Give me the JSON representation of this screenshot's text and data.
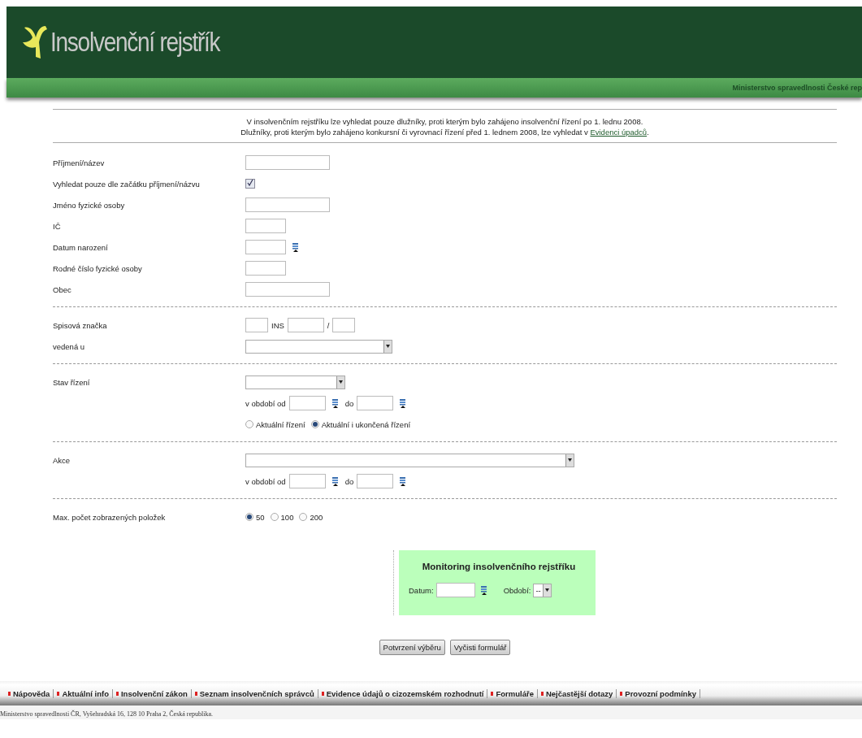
{
  "header": {
    "title": "Insolvenční rejstřík",
    "ministry": "Ministerstvo spravedlnosti České rep"
  },
  "notice": {
    "line_1": "V insolvenčním rejstříku lze vyhledat pouze dlužníky, proti kterým bylo zahájeno insolvenční řízení po 1. lednu 2008.",
    "line_2": "Dlužníky, proti kterým bylo zahájeno konkursní či vyrovnací řízení před 1. lednem 2008, lze vyhledat v",
    "link": "Evidenci úpadců",
    "line_2_end": "."
  },
  "sections": [
    {
      "rows": [
        {
          "label": "Příjmení/název",
          "controls": [
            {
              "kind": "input"
            }
          ]
        },
        {
          "label": "Vyhledat pouze dle začátku příjmení/názvu",
          "controls": [
            {
              "kind": "checkbox",
              "checked": true
            }
          ]
        },
        {
          "label": "Jméno fyzické osoby",
          "controls": [
            {
              "kind": "input"
            }
          ]
        },
        {
          "label": "IČ",
          "controls": [
            {
              "kind": "short-input"
            }
          ]
        },
        {
          "label": "Datum narození",
          "controls": [
            {
              "kind": "short-input"
            },
            {
              "kind": "calendar"
            }
          ]
        },
        {
          "label": "Rodné číslo fyzické osoby",
          "controls": [
            {
              "kind": "short-input"
            }
          ]
        },
        {
          "label": "Obec",
          "controls": [
            {
              "kind": "input"
            }
          ]
        }
      ]
    },
    {
      "rows": [
        {
          "label": "Spisová značka",
          "controls": [
            {
              "kind": "tiny-input"
            },
            {
              "kind": "text",
              "text": "INS"
            },
            {
              "kind": "input-45"
            },
            {
              "kind": "text",
              "text": "/"
            },
            {
              "kind": "tiny-input"
            }
          ]
        },
        {
          "label": "vedená u",
          "controls": [
            {
              "kind": "select"
            }
          ]
        }
      ]
    },
    {
      "rows": [
        {
          "label": "Stav řízení",
          "controls": [
            {
              "kind": "short-select"
            }
          ]
        },
        {
          "controls": [
            {
              "kind": "text",
              "text": "v období od"
            },
            {
              "kind": "input-45"
            },
            {
              "kind": "calendar"
            },
            {
              "kind": "text",
              "text": "do"
            },
            {
              "kind": "input-45"
            },
            {
              "kind": "calendar"
            }
          ]
        },
        {
          "controls": [
            {
              "kind": "radio",
              "label": "Aktuální řízení",
              "selected": false
            },
            {
              "kind": "radio",
              "label": "Aktuální i ukončená řízení",
              "selected": true
            }
          ]
        }
      ]
    },
    {
      "rows": [
        {
          "label": "Akce",
          "controls": [
            {
              "kind": "long-select"
            }
          ]
        },
        {
          "controls": [
            {
              "kind": "text",
              "text": "v období od"
            },
            {
              "kind": "input-45"
            },
            {
              "kind": "calendar"
            },
            {
              "kind": "text",
              "text": "do"
            },
            {
              "kind": "input-45"
            },
            {
              "kind": "calendar"
            }
          ]
        }
      ]
    },
    {
      "rows": [
        {
          "label": "Max. počet zobrazených položek",
          "controls": [
            {
              "kind": "radio",
              "label": "50",
              "selected": true
            },
            {
              "kind": "radio",
              "label": "100",
              "selected": false
            },
            {
              "kind": "radio",
              "label": "200",
              "selected": false
            }
          ]
        }
      ]
    }
  ],
  "monitoring": {
    "title": "Monitoring insolvenčního rejstříku",
    "date_label": "Datum:",
    "period_label": "Období:",
    "period_value": "--"
  },
  "buttons": [
    "Potvrzení výběru",
    "Vyčisti formulář"
  ],
  "footer": {
    "links": [
      "Nápověda",
      "Aktuální info",
      "Insolvenční zákon",
      "Seznam insolvenčních správců",
      "Evidence údajů o cizozemském rozhodnutí",
      "Formuláře",
      "Nejčastější dotazy",
      "Provozní podmínky"
    ],
    "address": "Ministerstvo spravedlnosti ČR, Vyšehradská 16, 128 10 Praha 2, Česká republika."
  }
}
